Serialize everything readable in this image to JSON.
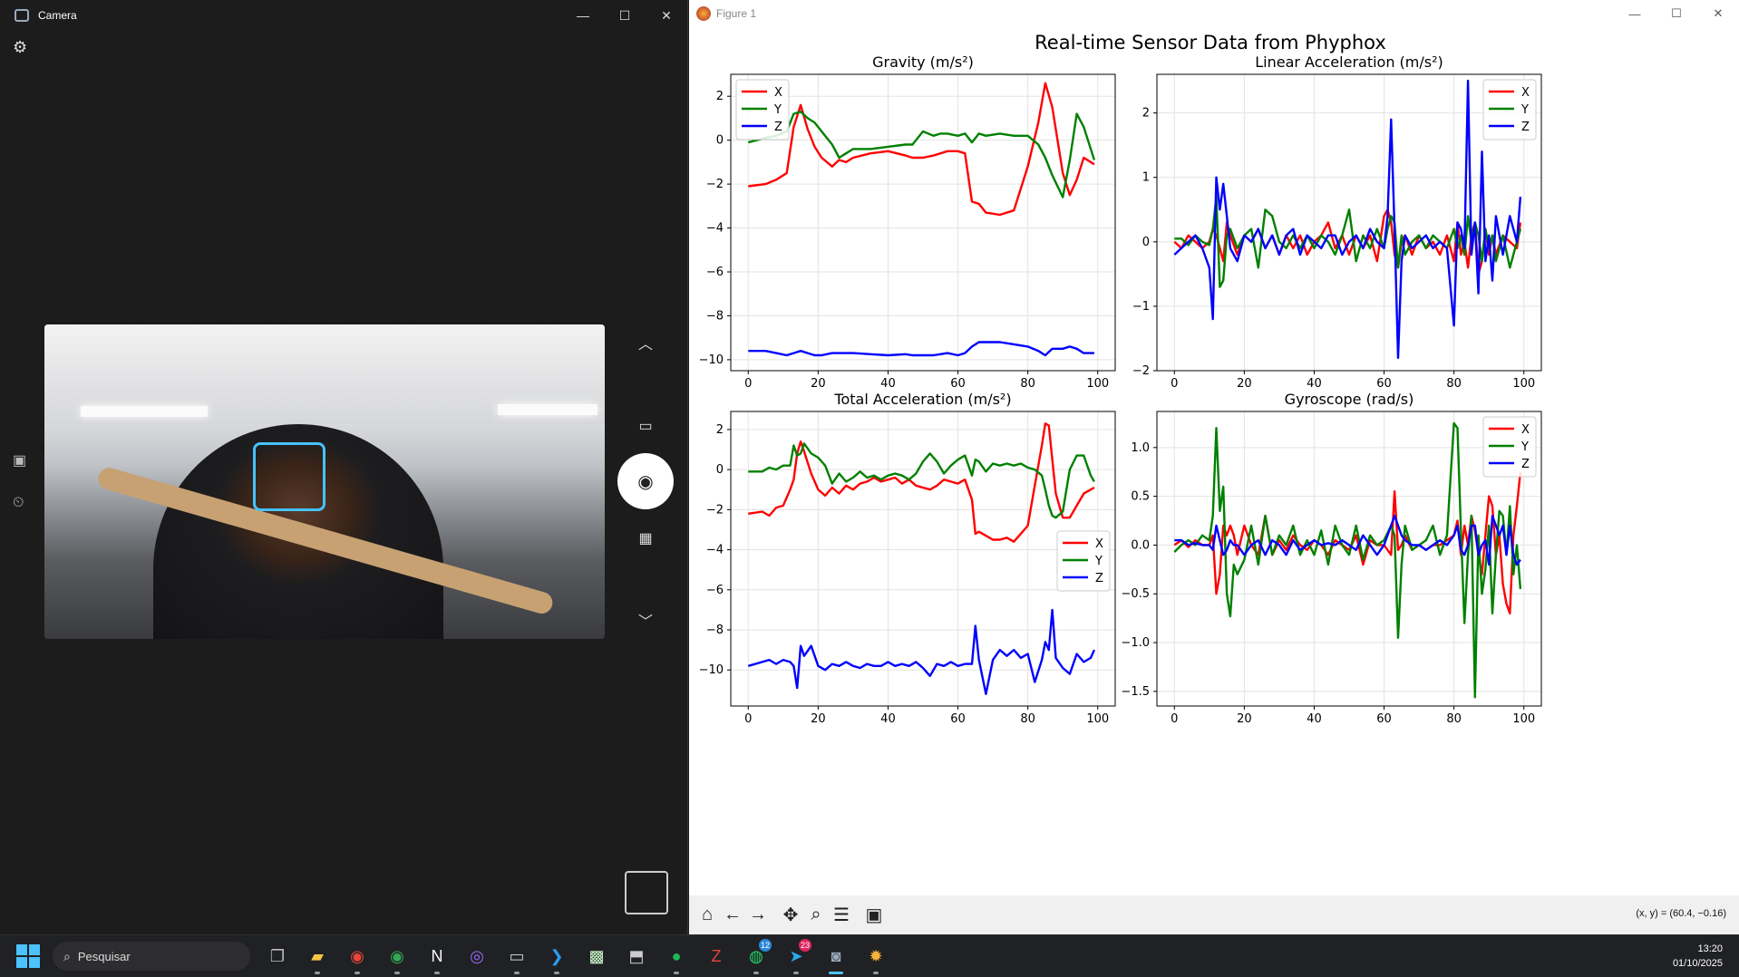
{
  "camera": {
    "title": "Camera",
    "controls": {
      "minimize": "—",
      "maximize": "☐",
      "close": "✕"
    }
  },
  "figure": {
    "window_title": "Figure 1",
    "controls": {
      "minimize": "—",
      "maximize": "☐",
      "close": "✕"
    },
    "coords": "(x, y) = (60.4, −0.16)"
  },
  "taskbar": {
    "search_placeholder": "Pesquisar",
    "time": "13:20",
    "date": "01/10/2025",
    "badges": {
      "whatsapp": "12",
      "telegram": "23"
    }
  },
  "chart_data": [
    {
      "type": "line",
      "suptitle": "Real-time Sensor Data from Phyphox",
      "title": "Gravity (m/s²)",
      "ylim": [
        -10.5,
        3
      ],
      "xlim": [
        -5,
        105
      ],
      "xticks": [
        0,
        20,
        40,
        60,
        80,
        100
      ],
      "yticks": [
        2,
        0,
        -2,
        -4,
        -6,
        -8,
        -10
      ],
      "ytick_labels": [
        "2",
        "0",
        "−2",
        "−4",
        "−6",
        "−8",
        "−10"
      ],
      "legend": "top-left",
      "x": [
        0,
        5,
        8,
        11,
        13,
        15,
        17,
        19,
        21,
        24,
        26,
        28,
        30,
        35,
        40,
        45,
        47,
        50,
        53,
        55,
        57,
        60,
        62,
        64,
        66,
        68,
        72,
        76,
        80,
        83,
        85,
        87,
        90,
        92,
        94,
        96,
        99
      ],
      "series": [
        {
          "name": "X",
          "color": "#ff0000",
          "values": [
            -2.1,
            -2.0,
            -1.8,
            -1.5,
            0.6,
            1.6,
            0.5,
            -0.3,
            -0.8,
            -1.2,
            -0.9,
            -1.0,
            -0.8,
            -0.6,
            -0.5,
            -0.7,
            -0.8,
            -0.8,
            -0.7,
            -0.6,
            -0.5,
            -0.5,
            -0.6,
            -2.8,
            -2.9,
            -3.3,
            -3.4,
            -3.2,
            -1.2,
            0.8,
            2.6,
            1.5,
            -1.5,
            -2.5,
            -1.8,
            -0.8,
            -1.1
          ]
        },
        {
          "name": "Y",
          "color": "#008000",
          "values": [
            -0.1,
            0.1,
            0.2,
            0.4,
            1.2,
            1.3,
            1.0,
            0.8,
            0.4,
            -0.2,
            -0.8,
            -0.6,
            -0.4,
            -0.4,
            -0.3,
            -0.2,
            -0.2,
            0.4,
            0.2,
            0.3,
            0.3,
            0.2,
            0.3,
            -0.1,
            0.3,
            0.2,
            0.3,
            0.2,
            0.2,
            -0.2,
            -0.8,
            -1.6,
            -2.6,
            -0.9,
            1.2,
            0.6,
            -0.9
          ]
        },
        {
          "name": "Z",
          "color": "#0000ff",
          "values": [
            -9.6,
            -9.6,
            -9.7,
            -9.8,
            -9.7,
            -9.6,
            -9.7,
            -9.8,
            -9.8,
            -9.7,
            -9.7,
            -9.7,
            -9.7,
            -9.75,
            -9.8,
            -9.75,
            -9.8,
            -9.8,
            -9.8,
            -9.75,
            -9.7,
            -9.8,
            -9.7,
            -9.4,
            -9.2,
            -9.2,
            -9.2,
            -9.3,
            -9.4,
            -9.6,
            -9.8,
            -9.5,
            -9.5,
            -9.4,
            -9.5,
            -9.7,
            -9.7
          ]
        }
      ]
    },
    {
      "type": "line",
      "title": "Linear Acceleration (m/s²)",
      "ylim": [
        -2,
        2.6
      ],
      "xlim": [
        -5,
        105
      ],
      "xticks": [
        0,
        20,
        40,
        60,
        80,
        100
      ],
      "yticks": [
        2,
        1,
        0,
        -1,
        -2
      ],
      "ytick_labels": [
        "2",
        "1",
        "0",
        "−1",
        "−2"
      ],
      "legend": "top-right",
      "x": [
        0,
        2,
        4,
        6,
        8,
        10,
        11,
        12,
        13,
        14,
        15,
        16,
        18,
        20,
        22,
        24,
        26,
        28,
        30,
        32,
        34,
        36,
        38,
        40,
        42,
        44,
        46,
        48,
        50,
        52,
        54,
        56,
        58,
        60,
        61,
        62,
        63,
        64,
        65,
        66,
        68,
        70,
        72,
        74,
        76,
        78,
        80,
        81,
        82,
        83,
        84,
        85,
        86,
        87,
        88,
        89,
        90,
        91,
        92,
        94,
        96,
        98,
        99
      ],
      "series": [
        {
          "name": "X",
          "color": "#ff0000",
          "values": [
            0,
            -0.1,
            0.1,
            0,
            -0.1,
            0,
            0.2,
            0.1,
            -0.1,
            -0.3,
            0.3,
            0.1,
            -0.2,
            0.1,
            0,
            0.2,
            -0.1,
            0.1,
            -0.2,
            0.1,
            -0.1,
            0.1,
            -0.2,
            0,
            0.1,
            0.3,
            -0.1,
            0.1,
            -0.2,
            0.1,
            -0.1,
            0.1,
            -0.3,
            0.4,
            0.5,
            0.3,
            -0.2,
            -0.4,
            0,
            0.1,
            -0.2,
            0.1,
            -0.1,
            0,
            -0.2,
            0.1,
            -0.3,
            0.3,
            -0.2,
            0,
            -0.4,
            0.1,
            0.3,
            -0.5,
            -0.3,
            0.2,
            -0.2,
            0.1,
            -0.2,
            0.1,
            0,
            -0.1,
            0.3
          ]
        },
        {
          "name": "Y",
          "color": "#008000",
          "values": [
            0.05,
            0.05,
            -0.05,
            0.1,
            0,
            -0.05,
            0.2,
            0.7,
            -0.7,
            -0.6,
            0.1,
            0.2,
            -0.1,
            0.1,
            0.2,
            -0.4,
            0.5,
            0.4,
            0,
            -0.1,
            0.1,
            -0.1,
            0.1,
            -0.1,
            0.1,
            0,
            -0.2,
            0.1,
            0.5,
            -0.3,
            0.1,
            -0.1,
            0.2,
            -0.1,
            0.2,
            0.4,
            0.3,
            -0.4,
            0.1,
            -0.2,
            0,
            0.1,
            -0.1,
            0.1,
            0,
            -0.1,
            0.2,
            -0.1,
            0.1,
            -0.2,
            0.4,
            0,
            0.3,
            0.1,
            -0.3,
            0.2,
            -0.1,
            0.1,
            -0.3,
            0.1,
            -0.4,
            0,
            0.2
          ]
        },
        {
          "name": "Z",
          "color": "#0000ff",
          "values": [
            -0.2,
            -0.1,
            0,
            0.1,
            -0.1,
            -0.4,
            -1.2,
            1.0,
            0.5,
            0.9,
            0.4,
            -0.1,
            -0.3,
            0.1,
            0,
            0.2,
            -0.1,
            0.1,
            -0.2,
            0.1,
            0.2,
            -0.2,
            0.1,
            0,
            -0.1,
            0.1,
            0.1,
            -0.2,
            0,
            0.1,
            -0.1,
            0.2,
            0,
            -0.1,
            0.4,
            1.9,
            0.2,
            -1.8,
            -0.3,
            0.1,
            -0.1,
            0,
            0.1,
            -0.1,
            0,
            -0.1,
            -1.3,
            0.3,
            0.2,
            -0.1,
            2.5,
            -0.2,
            0.3,
            -0.8,
            1.4,
            -0.3,
            0.1,
            -0.6,
            0.4,
            -0.2,
            0.4,
            0,
            0.7
          ]
        }
      ]
    },
    {
      "type": "line",
      "title": "Total Acceleration (m/s²)",
      "ylim": [
        -11.8,
        2.9
      ],
      "xlim": [
        -5,
        105
      ],
      "xticks": [
        0,
        20,
        40,
        60,
        80,
        100
      ],
      "yticks": [
        2,
        0,
        -2,
        -4,
        -6,
        -8,
        -10
      ],
      "ytick_labels": [
        "2",
        "0",
        "−2",
        "−4",
        "−6",
        "−8",
        "−10"
      ],
      "legend": "center-right",
      "x": [
        0,
        4,
        6,
        8,
        10,
        12,
        13,
        14,
        15,
        16,
        18,
        20,
        22,
        24,
        26,
        28,
        30,
        32,
        34,
        36,
        38,
        40,
        42,
        44,
        46,
        48,
        50,
        52,
        54,
        56,
        58,
        60,
        62,
        64,
        65,
        66,
        68,
        70,
        72,
        74,
        76,
        78,
        80,
        82,
        84,
        85,
        86,
        87,
        88,
        90,
        92,
        94,
        96,
        98,
        99
      ],
      "series": [
        {
          "name": "X",
          "color": "#ff0000",
          "values": [
            -2.2,
            -2.1,
            -2.3,
            -1.9,
            -1.8,
            -1.0,
            -0.5,
            0.8,
            1.4,
            0.9,
            -0.2,
            -1.0,
            -1.3,
            -0.9,
            -1.2,
            -0.8,
            -1.0,
            -0.7,
            -0.6,
            -0.4,
            -0.6,
            -0.5,
            -0.4,
            -0.7,
            -0.5,
            -0.8,
            -0.9,
            -1.0,
            -0.8,
            -0.5,
            -0.6,
            -0.7,
            -0.5,
            -1.5,
            -3.2,
            -3.1,
            -3.3,
            -3.5,
            -3.5,
            -3.4,
            -3.6,
            -3.2,
            -2.8,
            -0.8,
            1.2,
            2.3,
            2.2,
            0.5,
            -1.2,
            -2.4,
            -2.4,
            -1.8,
            -1.2,
            -1.0,
            -0.9
          ]
        },
        {
          "name": "Y",
          "color": "#008000",
          "values": [
            -0.1,
            -0.1,
            0.1,
            0,
            0.2,
            0.2,
            1.2,
            0.7,
            0.8,
            1.3,
            0.8,
            0.6,
            0.2,
            -0.7,
            -0.2,
            -0.6,
            -0.4,
            -0.1,
            -0.4,
            -0.3,
            -0.5,
            -0.3,
            -0.2,
            -0.3,
            -0.5,
            -0.2,
            0.4,
            0.8,
            0.4,
            -0.2,
            0.2,
            0.5,
            0.7,
            -0.3,
            0.5,
            0.4,
            -0.1,
            0.3,
            0.2,
            0.3,
            0.2,
            0.3,
            0.1,
            0,
            -0.3,
            -1.0,
            -1.8,
            -2.3,
            -2.4,
            -2.1,
            0,
            0.7,
            0.7,
            -0.3,
            -0.6
          ]
        },
        {
          "name": "Z",
          "color": "#0000ff",
          "values": [
            -9.8,
            -9.6,
            -9.5,
            -9.7,
            -9.5,
            -9.6,
            -9.8,
            -10.9,
            -8.8,
            -9.3,
            -8.8,
            -9.8,
            -10.0,
            -9.7,
            -9.8,
            -9.6,
            -9.8,
            -9.9,
            -9.7,
            -9.8,
            -9.8,
            -9.6,
            -9.8,
            -9.7,
            -9.8,
            -9.6,
            -9.9,
            -10.3,
            -9.7,
            -9.8,
            -9.6,
            -9.8,
            -9.7,
            -9.7,
            -7.8,
            -9.5,
            -11.2,
            -9.5,
            -9.0,
            -9.3,
            -9.0,
            -9.4,
            -9.2,
            -10.6,
            -9.5,
            -8.6,
            -9.0,
            -7.0,
            -9.4,
            -9.9,
            -10.2,
            -9.2,
            -9.6,
            -9.4,
            -9.0
          ]
        }
      ]
    },
    {
      "type": "line",
      "title": "Gyroscope (rad/s)",
      "ylim": [
        -1.65,
        1.37
      ],
      "xlim": [
        -5,
        105
      ],
      "xticks": [
        0,
        20,
        40,
        60,
        80,
        100
      ],
      "yticks": [
        1.0,
        0.5,
        0.0,
        -0.5,
        -1.0,
        -1.5
      ],
      "ytick_labels": [
        "1.0",
        "0.5",
        "0.0",
        "−0.5",
        "−1.0",
        "−1.5"
      ],
      "legend": "top-right",
      "x": [
        0,
        2,
        4,
        6,
        8,
        10,
        11,
        12,
        13,
        14,
        15,
        16,
        17,
        18,
        20,
        22,
        24,
        26,
        28,
        30,
        32,
        34,
        36,
        38,
        40,
        42,
        44,
        46,
        48,
        50,
        52,
        54,
        56,
        58,
        60,
        62,
        63,
        64,
        65,
        66,
        68,
        70,
        72,
        74,
        76,
        78,
        80,
        81,
        82,
        83,
        84,
        85,
        86,
        87,
        88,
        89,
        90,
        91,
        92,
        93,
        94,
        95,
        96,
        97,
        98,
        99
      ],
      "series": [
        {
          "name": "X",
          "color": "#ff0000",
          "values": [
            0,
            0.05,
            -0.02,
            0.05,
            0,
            0,
            0.1,
            -0.5,
            -0.3,
            0.2,
            0.1,
            0.2,
            0.1,
            -0.1,
            0.2,
            0,
            -0.1,
            0.3,
            -0.1,
            0.05,
            -0.05,
            0.1,
            0,
            -0.05,
            0.05,
            0,
            -0.1,
            0.05,
            0,
            -0.05,
            0.1,
            -0.2,
            0.05,
            0,
            0,
            -0.1,
            0.55,
            -0.05,
            0,
            0.1,
            -0.05,
            0,
            -0.05,
            0,
            0,
            0.05,
            0.1,
            0.25,
            -0.1,
            0.2,
            0,
            0.3,
            0.15,
            -0.1,
            -0.3,
            0.1,
            0.5,
            0.4,
            -0.1,
            0.1,
            -0.4,
            -0.6,
            -0.7,
            0.1,
            0.4,
            0.75
          ]
        },
        {
          "name": "Y",
          "color": "#008000",
          "values": [
            -0.07,
            0,
            0.05,
            0,
            0.1,
            0.05,
            0.3,
            1.2,
            0.35,
            0.6,
            -0.5,
            -0.73,
            -0.2,
            -0.3,
            -0.15,
            0.2,
            -0.2,
            0.3,
            -0.1,
            0.1,
            0,
            0.2,
            -0.1,
            0.05,
            -0.1,
            0.15,
            -0.2,
            0.2,
            0,
            -0.1,
            0.2,
            -0.15,
            0.1,
            0,
            0.05,
            0.2,
            0.1,
            -0.95,
            -0.2,
            0.2,
            -0.05,
            0,
            0.05,
            0.2,
            -0.1,
            0.1,
            1.25,
            1.2,
            0.15,
            -0.8,
            -0.1,
            0.3,
            -1.56,
            0.1,
            -0.5,
            -0.25,
            0.2,
            -0.7,
            -0.1,
            0.35,
            0.3,
            -0.1,
            0.4,
            -0.3,
            0,
            -0.45
          ]
        },
        {
          "name": "Z",
          "color": "#0000ff",
          "values": [
            0.05,
            0.05,
            0,
            0.02,
            0,
            0,
            -0.05,
            0.2,
            0.05,
            -0.1,
            -0.05,
            0.05,
            0,
            0,
            -0.1,
            0,
            0.05,
            -0.1,
            0.05,
            0,
            -0.1,
            0.05,
            -0.05,
            0,
            0.05,
            0,
            0.02,
            0,
            0.05,
            0,
            -0.05,
            0.1,
            0,
            -0.1,
            0,
            0.2,
            0.3,
            0.2,
            0.1,
            0.05,
            0,
            0,
            -0.05,
            0,
            0.05,
            0,
            0.1,
            0.2,
            -0.05,
            -0.1,
            0,
            0.2,
            0.2,
            -0.1,
            0,
            0.05,
            -0.2,
            0.3,
            0.2,
            0.1,
            0.2,
            -0.1,
            0.2,
            -0.1,
            -0.2,
            -0.15
          ]
        }
      ]
    }
  ]
}
